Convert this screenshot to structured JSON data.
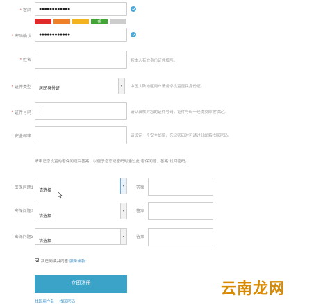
{
  "form": {
    "password": {
      "label": "密码",
      "value": "●●●●●●●●●●●●",
      "strength_colors": [
        "#e02a2a",
        "#f07f2a",
        "#f2b31f",
        "#43a535",
        "#cccccc"
      ],
      "strength_label": "强"
    },
    "password_confirm": {
      "label": "密码确认",
      "value": "●●●●●●●●●●●●"
    },
    "name": {
      "label": "姓名",
      "hint": "按本人有效身份证件填写。"
    },
    "id_type": {
      "label": "证件类型",
      "value": "居民身份证",
      "hint": "中国大陆地区用户请务必设置居民身份证。"
    },
    "id_number": {
      "label": "证件号码",
      "hint": "请认真核对您的证件号码，证件号码一经提交即被锁定。"
    },
    "email": {
      "label": "安全邮箱",
      "hint": "请设定一个安全邮箱，忘记密码时可通过此邮箱找回密码。"
    },
    "security_note": "请牢记您设置的密保问题及答案，以便于您忘记密码时通过此\"密保问题、答案\"找回密码。",
    "questions": [
      {
        "label": "密保问题1",
        "placeholder": "请选择",
        "answer_label": "答案"
      },
      {
        "label": "密保问题2",
        "placeholder": "请选择",
        "answer_label": "答案"
      },
      {
        "label": "密保问题3",
        "placeholder": "请选择",
        "answer_label": "答案"
      }
    ],
    "agree_prefix": "我已阅读并同意",
    "agree_link": "\"服务条款\"",
    "submit_label": "立即注册",
    "footer_links": [
      "找回用户名",
      "找回密码"
    ]
  },
  "watermark": "云南龙网",
  "colors": {
    "accent": "#3ca3c8",
    "check": "#49a6d6",
    "required": "#d9534f"
  }
}
